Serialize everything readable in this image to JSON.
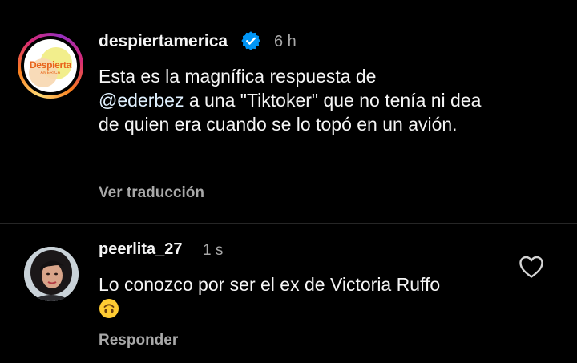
{
  "post": {
    "username": "despiertamerica",
    "time": "6 h",
    "logo_text": "Despierta",
    "logo_subtext": "AMÉRICA",
    "caption_before": "Esta es la magnífica respuesta de",
    "mention": "@ederbez",
    "caption_after": " a una \"Tiktoker\" que no tenía ni dea de quien era cuando se lo topó en un avión.",
    "translate_label": "Ver traducción"
  },
  "comment": {
    "username": "peerlita_27",
    "time": "1 s",
    "text": "Lo conozco por ser el ex de Victoria Ruffo ",
    "reply_label": "Responder"
  },
  "colors": {
    "background": "#000000",
    "text": "#f5f5f5",
    "muted": "#a8a8a8",
    "verified": "#0095f6",
    "divider": "#262626"
  },
  "icons": {
    "verified": "verified-badge-icon",
    "like": "heart-outline-icon",
    "emoji": "upside-down-face-emoji"
  }
}
